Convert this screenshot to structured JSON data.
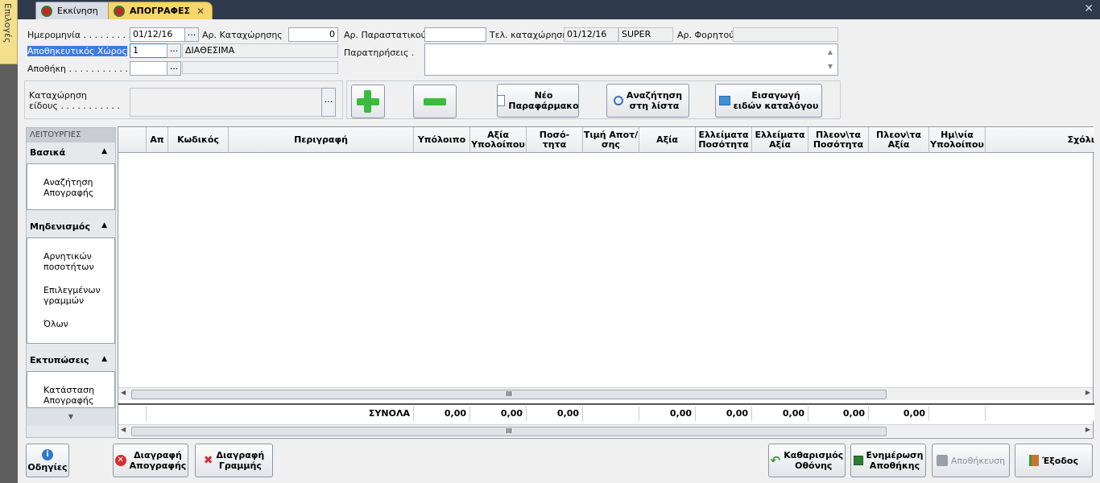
{
  "sidebar_tab": {
    "label": "Επιλογές"
  },
  "tabs": [
    {
      "label": "Εκκίνηση"
    },
    {
      "label": "ΑΠΟΓΡΑΦΕΣ"
    }
  ],
  "form": {
    "date_label": "Ημερομηνία . . . . . . . . .",
    "date_value": "01/12/16",
    "reg_no_label": "Αρ. Καταχώρησης",
    "reg_no_value": "0",
    "doc_no_label": "Αρ. Παραστατικού .",
    "doc_no_value": "",
    "last_entry_label": "Τελ. καταχώρηση",
    "last_entry_date": "01/12/16",
    "last_entry_user": "SUPER",
    "cargo_label": "Αρ. Φορητού",
    "cargo_value": "",
    "storage_label": "Αποθηκευτικός Χώρος",
    "storage_value": "1",
    "storage_name": "ΔΙΑΘΕΣΙΜΑ",
    "warehouse_label": "Αποθήκη . . . . . . . . . . . .",
    "warehouse_value": "",
    "notes_label": "Παρατηρήσεις .",
    "notes_value": "",
    "item_entry_label_1": "Καταχώρηση",
    "item_entry_label_2": "είδους . . . . . . . . . . ."
  },
  "actions": {
    "new_drug": [
      "Νέο",
      "Παραφάρμακο"
    ],
    "search_list": [
      "Αναζήτηση",
      "στη λίστα"
    ],
    "import_catalog": [
      "Εισαγωγή",
      "ειδών καταλόγου"
    ]
  },
  "leftnav": {
    "header": "ΛΕΙΤΟΥΡΓΙΕΣ",
    "groups": [
      {
        "title": "Βασικά",
        "items": [
          "Αναζήτηση Απογραφής"
        ]
      },
      {
        "title": "Μηδενισμός",
        "items": [
          "Αρνητικών ποσοτήτων",
          "Επιλεγμένων γραμμών",
          "Όλων"
        ]
      },
      {
        "title": "Εκτυπώσεις",
        "items": [
          "Κατάσταση Απογραφής"
        ]
      }
    ]
  },
  "grid": {
    "columns": [
      "Απ",
      "Κωδικός",
      "Περιγραφή",
      "Υπόλοιπο",
      "Αξία Υπολοίπου",
      "Ποσό-τητα",
      "Τιμή Αποτ/σης",
      "Αξία",
      "Ελλείματα Ποσότητα",
      "Ελλείματα Αξία",
      "Πλεον\\τα Ποσότητα",
      "Πλεον\\τα Αξία",
      "Ημ\\νία Υπολοίπου",
      "Σχόλι"
    ],
    "totals_label": "ΣΥΝΟΛΑ",
    "totals": [
      "0,00",
      "0,00",
      "0,00",
      "0,00",
      "0,00",
      "0,00",
      "0,00",
      "0,00"
    ],
    "scroll_grip": "III"
  },
  "bottom": {
    "help": "Οδηγίες",
    "delete_inventory": [
      "Διαγραφή",
      "Απογραφής"
    ],
    "delete_line": [
      "Διαγραφή",
      "Γραμμής"
    ],
    "clear_screen": [
      "Καθαρισμός",
      "Οθόνης"
    ],
    "update_warehouse": [
      "Ενημέρωση",
      "Αποθήκης"
    ],
    "save": "Αποθήκευση",
    "exit": "Έξοδος"
  }
}
